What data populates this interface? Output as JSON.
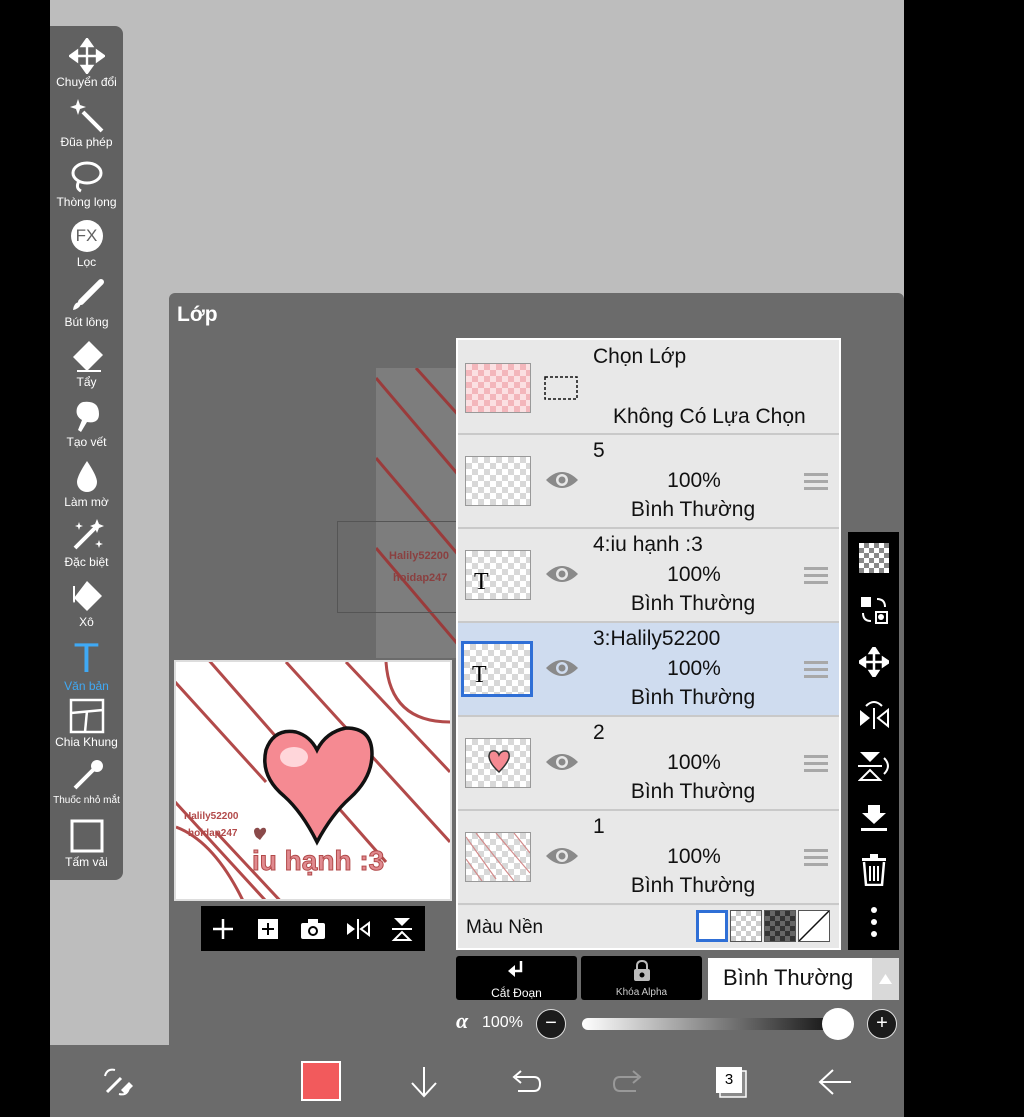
{
  "toolbar": {
    "tools": [
      {
        "label": "Chuyển đổi",
        "icon": "move-icon"
      },
      {
        "label": "Đũa phép",
        "icon": "magic-wand-icon"
      },
      {
        "label": "Thòng lọng",
        "icon": "lasso-icon"
      },
      {
        "label": "Lọc",
        "icon": "fx-icon",
        "glyph": "FX"
      },
      {
        "label": "Bút lông",
        "icon": "brush-icon"
      },
      {
        "label": "Tẩy",
        "icon": "eraser-icon"
      },
      {
        "label": "Tạo vết",
        "icon": "smudge-icon"
      },
      {
        "label": "Làm mờ",
        "icon": "blur-icon"
      },
      {
        "label": "Đặc biệt",
        "icon": "special-icon"
      },
      {
        "label": "Xô",
        "icon": "bucket-icon"
      },
      {
        "label": "Văn bản",
        "icon": "text-icon",
        "glyph": "T",
        "active": true
      },
      {
        "label": "Chia Khung",
        "icon": "frame-divider-icon"
      },
      {
        "label": "Thuốc nhỏ mắt",
        "icon": "eyedropper-icon"
      },
      {
        "label": "Tấm vải",
        "icon": "canvas-icon"
      }
    ]
  },
  "panel": {
    "title": "Lớp",
    "ghost_text_1": "Halily52200",
    "ghost_text_2": "hoidap247",
    "preview": {
      "watermark_1": "Halily52200",
      "watermark_2": "hoidap247",
      "caption": "iu hạnh :3"
    }
  },
  "selection_row": {
    "title": "Chọn Lớp",
    "status": "Không Có Lựa Chọn"
  },
  "layers": [
    {
      "name": "5",
      "opacity": "100%",
      "mode": "Bình Thường",
      "thumb": "empty"
    },
    {
      "name": "4:iu hạnh :3",
      "opacity": "100%",
      "mode": "Bình Thường",
      "thumb": "text",
      "thumb_glyph": "T"
    },
    {
      "name": "3:Halily52200",
      "opacity": "100%",
      "mode": "Bình Thường",
      "thumb": "text",
      "thumb_glyph": "T",
      "selected": true
    },
    {
      "name": "2",
      "opacity": "100%",
      "mode": "Bình Thường",
      "thumb": "heart"
    },
    {
      "name": "1",
      "opacity": "100%",
      "mode": "Bình Thường",
      "thumb": "lines"
    }
  ],
  "background_row": {
    "label": "Màu Nền"
  },
  "bottom_controls": {
    "clip_label": "Cắt Đoạn",
    "alpha_lock_label": "Khóa Alpha",
    "blend_mode": "Bình Thường",
    "alpha_symbol": "α",
    "opacity": "100%",
    "opacity_fraction": 1.0,
    "minus": "−",
    "plus": "+"
  },
  "bottom_bar": {
    "layer_count": "3",
    "color": "#f25a5c"
  },
  "colors": {
    "accent": "#3fa9f5",
    "selected_row": "#cfdcef",
    "selected_border": "#2f6fd6",
    "line_red": "#b24a4a",
    "heart_pink": "#f58a92"
  }
}
